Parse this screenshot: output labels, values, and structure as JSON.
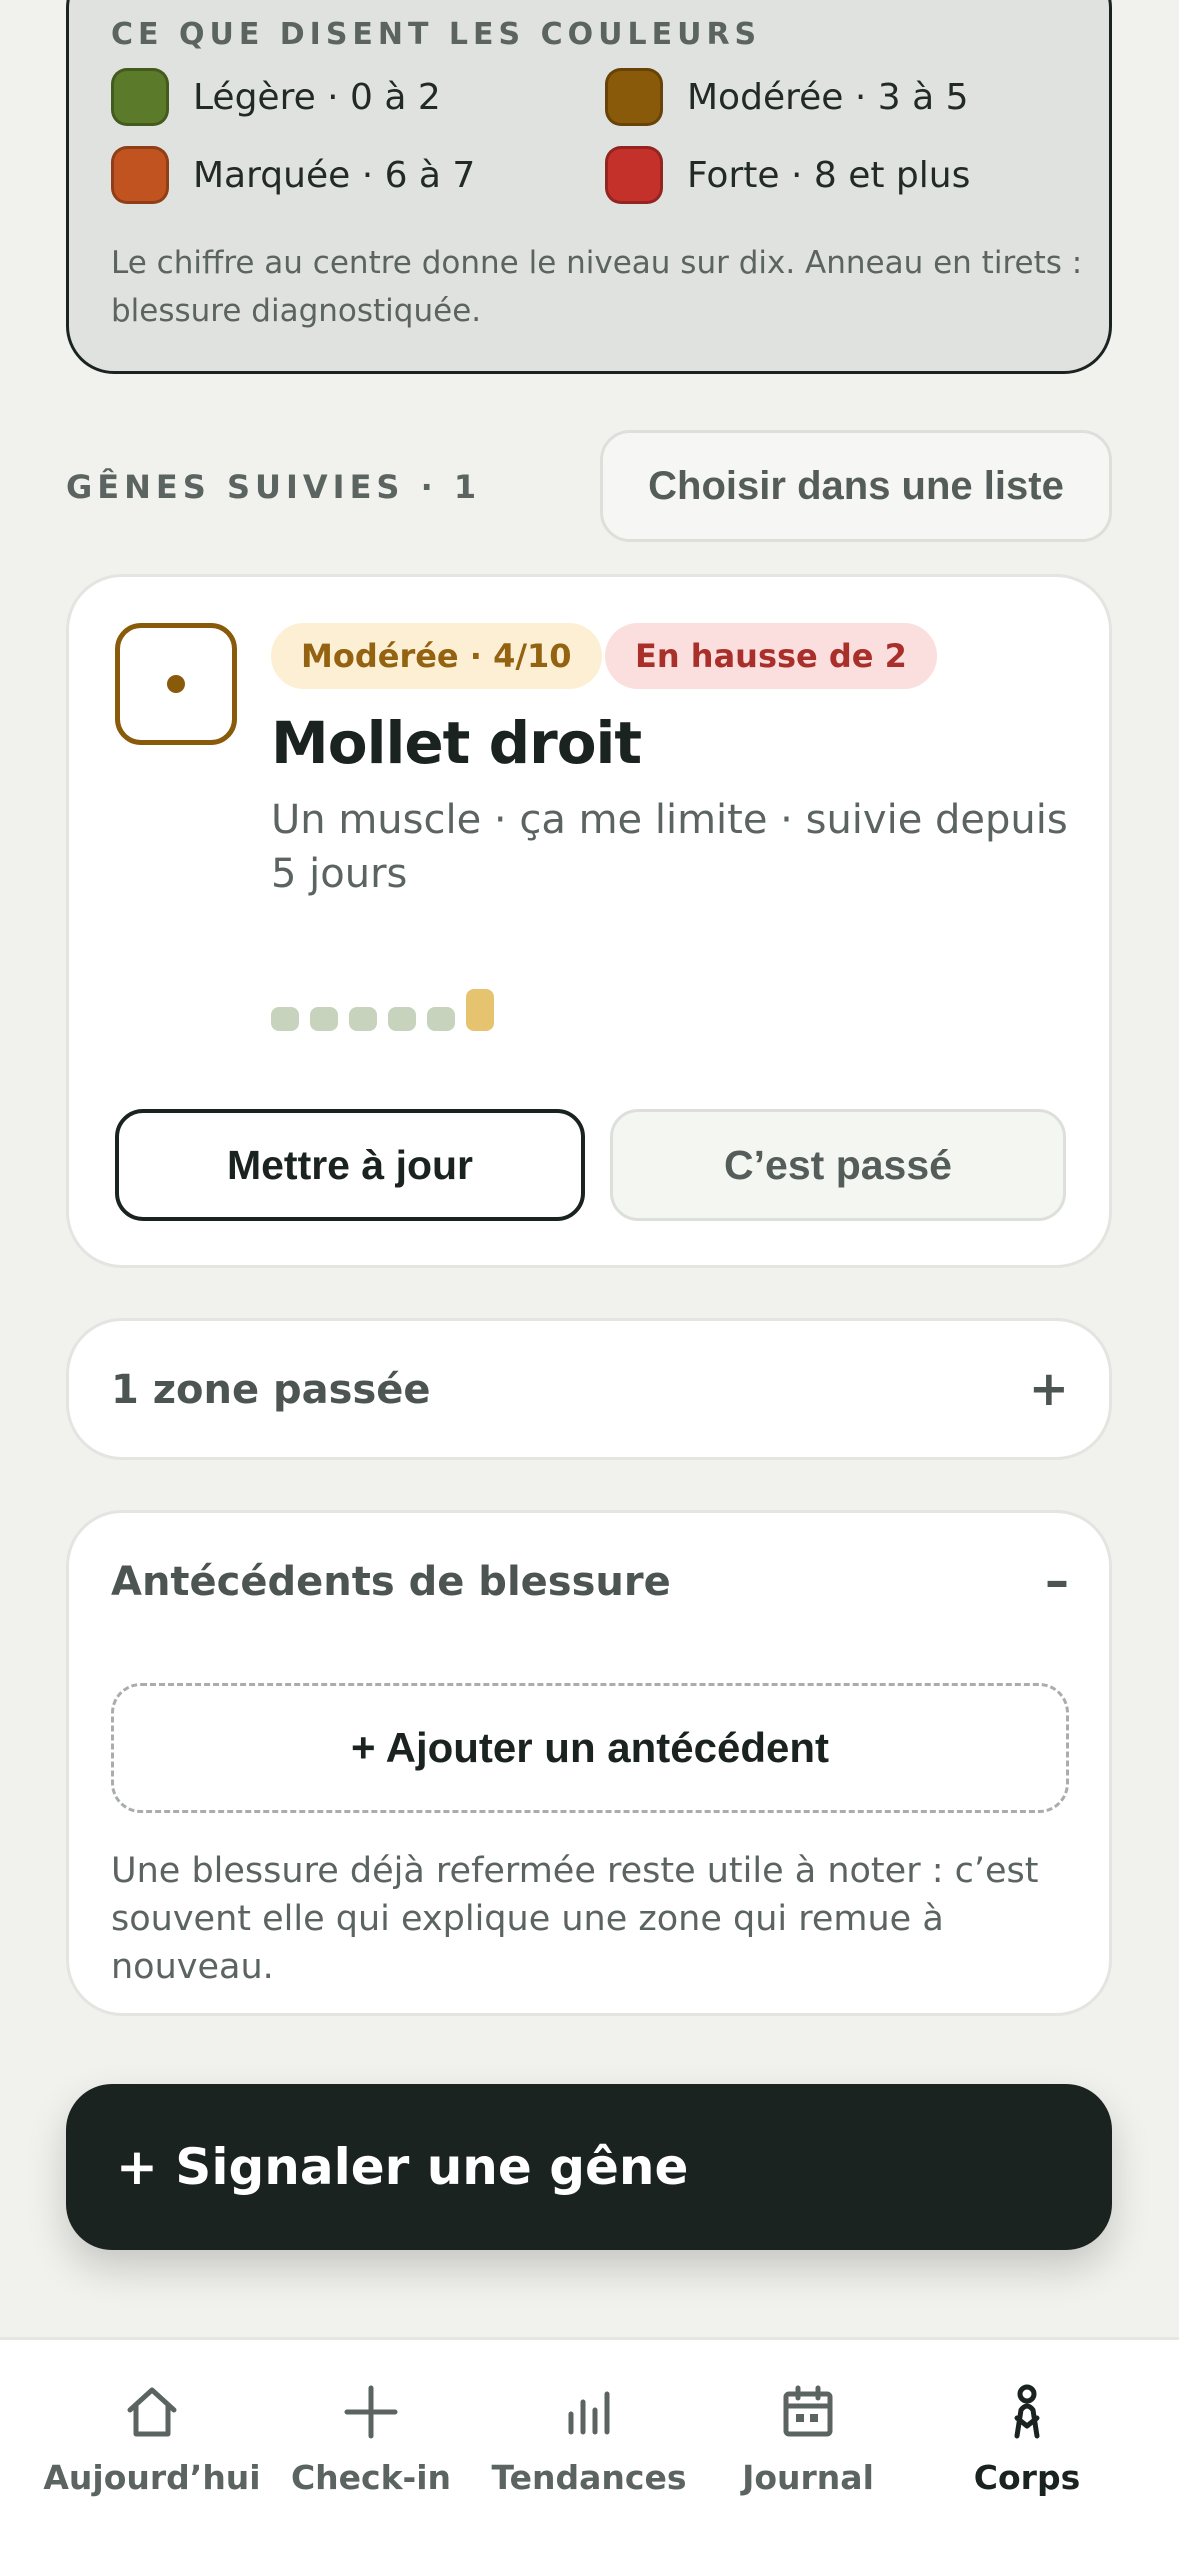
{
  "legend": {
    "title": "CE QUE DISENT LES COULEURS",
    "items": [
      {
        "label": "Légère · 0 à 2",
        "color": "#5b7a2a"
      },
      {
        "label": "Modérée · 3 à 5",
        "color": "#8a5a0b"
      },
      {
        "label": "Marquée · 6 à 7",
        "color": "#c0531f"
      },
      {
        "label": "Forte · 8 et plus",
        "color": "#c4312a"
      }
    ],
    "note": "Le chiffre au centre donne le niveau sur dix. Anneau en tirets : blessure diagnostiquée."
  },
  "tracked": {
    "title": "GÊNES SUIVIES · 1",
    "pick_label": "Choisir dans une liste"
  },
  "card": {
    "severity_badge": "Modérée · 4/10",
    "trend_badge": "En hausse de 2",
    "zone": "Mollet droit",
    "meta": "Un muscle · ça me limite · suivie depuis 5 jours",
    "update_label": "Mettre à jour",
    "passed_label": "C’est passé",
    "severity_color": "#8a5a0b",
    "history_levels": [
      1,
      1,
      1,
      1,
      1,
      2
    ]
  },
  "past_zones": {
    "title": "1 zone passée",
    "sign": "+"
  },
  "injury_history": {
    "title": "Antécédents de blessure",
    "sign": "–",
    "add_label": "+ Ajouter un antécédent",
    "note": "Une blessure déjà refermée reste utile à noter : c’est souvent elle qui explique une zone qui remue à nouveau."
  },
  "report_label": "+ Signaler une gêne",
  "nav": [
    {
      "label": "Aujourd’hui",
      "icon": "home-icon"
    },
    {
      "label": "Check-in",
      "icon": "plus-icon"
    },
    {
      "label": "Tendances",
      "icon": "bar-chart-icon"
    },
    {
      "label": "Journal",
      "icon": "calendar-icon"
    },
    {
      "label": "Corps",
      "icon": "body-icon",
      "active": true
    }
  ]
}
